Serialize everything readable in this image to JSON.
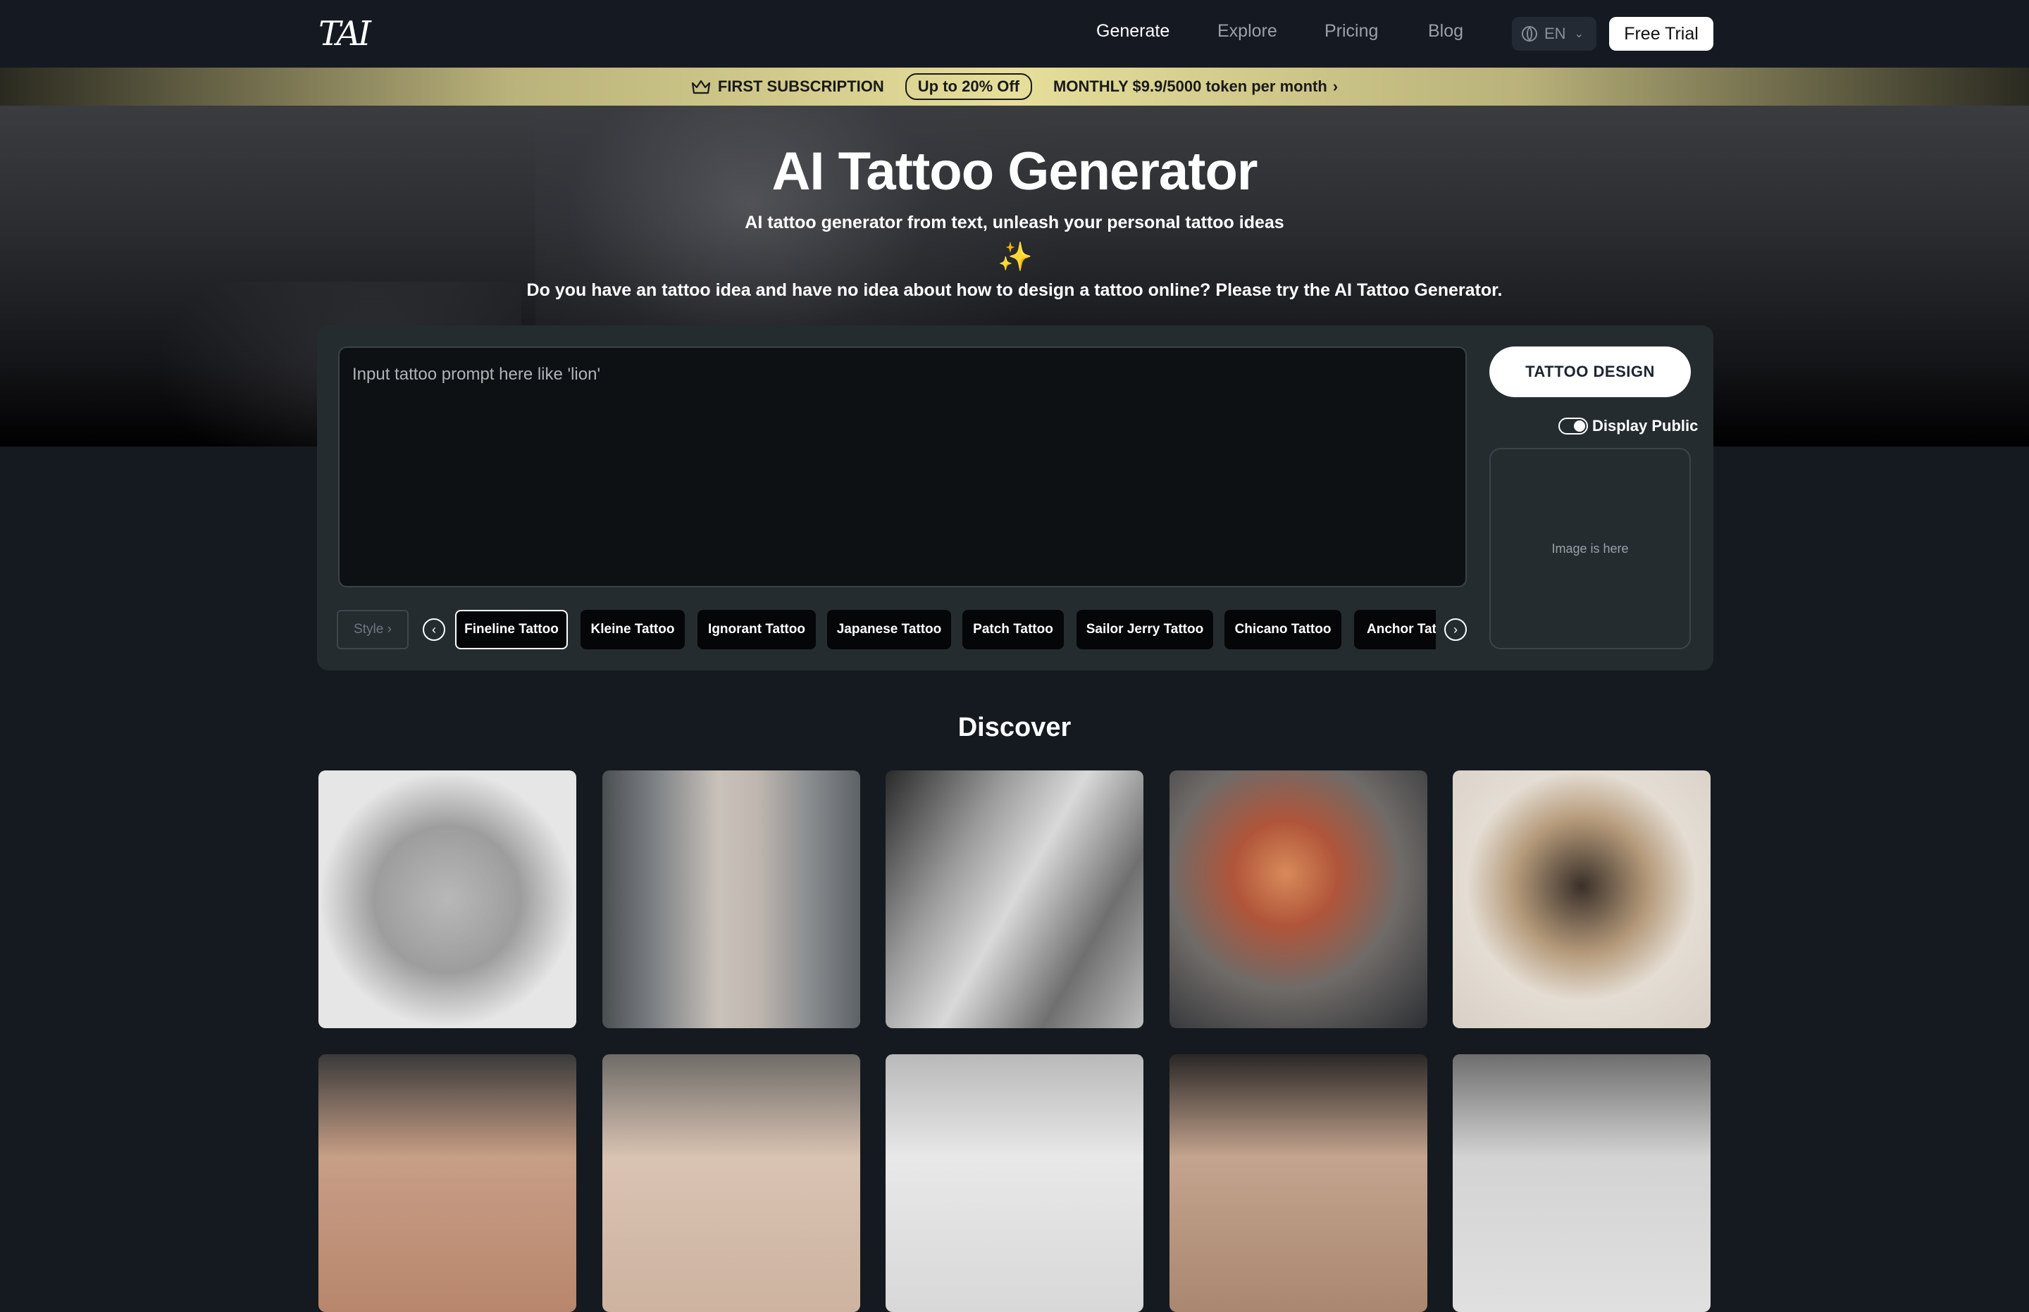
{
  "header": {
    "logo_text": "TAI",
    "nav": [
      "Generate",
      "Explore",
      "Pricing",
      "Blog"
    ],
    "language": "EN",
    "free_trial_label": "Free Trial"
  },
  "promo": {
    "label": "FIRST SUBSCRIPTION",
    "discount": "Up to 20% Off",
    "offer": "MONTHLY $9.9/5000 token per month",
    "chevron": "›"
  },
  "hero": {
    "title": "AI Tattoo Generator",
    "subtitle": "AI tattoo generator from text, unleash your personal tattoo ideas",
    "sparkle": "✨",
    "description": "Do you have an tattoo idea and have no idea about how to design a tattoo online? Please try the AI Tattoo Generator."
  },
  "generator": {
    "prompt_placeholder": "Input tattoo prompt here like 'lion'",
    "design_button": "TATTOO DESIGN",
    "display_public_label": "Display Public",
    "display_public_on": true,
    "image_placeholder": "Image is here",
    "style_label": "Style ›",
    "prev_arrow": "‹",
    "next_arrow": "›",
    "styles": [
      "Fineline Tattoo",
      "Kleine Tattoo",
      "Ignorant Tattoo",
      "Japanese Tattoo",
      "Patch Tattoo",
      "Sailor Jerry Tattoo",
      "Chicano Tattoo",
      "Anchor Tattoo"
    ],
    "selected_style": "Fineline Tattoo"
  },
  "discover": {
    "title": "Discover",
    "tiles": [
      "lion-floral-sketch",
      "floral-forearm-tattoo",
      "portrait-roses-tattoo",
      "woman-portrait-tattoo",
      "meerkat-illustration",
      "moon-star-tattoo",
      "arm-tattoo",
      "winged-emblem-sketch",
      "compass-tattoo",
      "flower-sketch"
    ]
  },
  "colors": {
    "background": "#151a20",
    "panel": "#242c30",
    "promo_gold": "#e6df9a"
  }
}
